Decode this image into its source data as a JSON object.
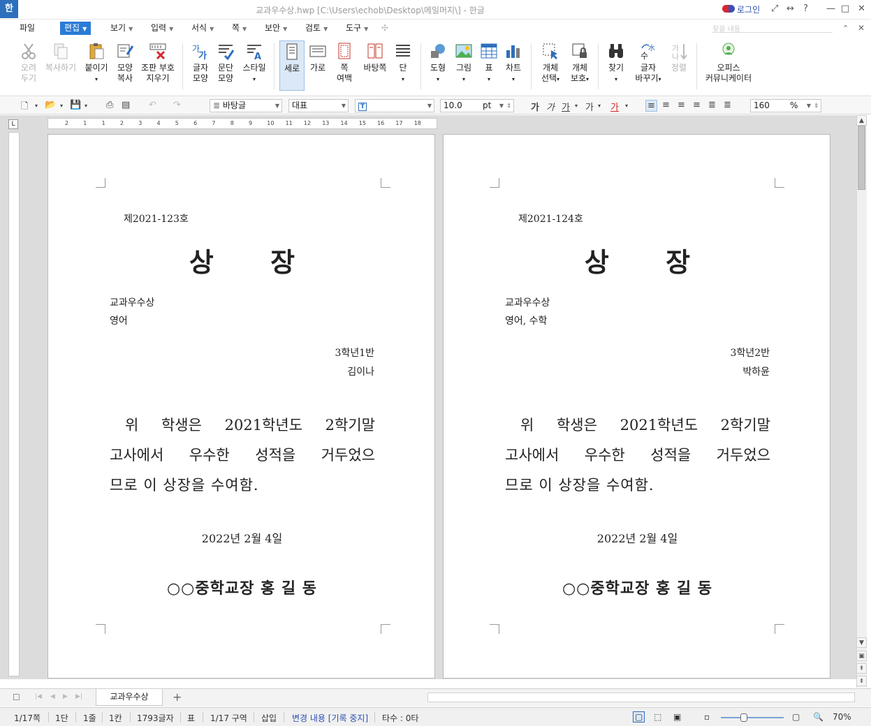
{
  "titlebar": {
    "app_logo": "한",
    "title": "교과우수상.hwp [C:\\Users\\echob\\Desktop\\메일머지\\] - 한글",
    "login": "로그인"
  },
  "menu": {
    "items": [
      {
        "label": "파일"
      },
      {
        "label": "편집"
      },
      {
        "label": "보기"
      },
      {
        "label": "입력"
      },
      {
        "label": "서식"
      },
      {
        "label": "쪽"
      },
      {
        "label": "보안"
      },
      {
        "label": "검토"
      },
      {
        "label": "도구"
      }
    ],
    "search_placeholder": "찾을 내용"
  },
  "ribbon": {
    "cut": [
      "오려",
      "두기"
    ],
    "copy": "복사하기",
    "paste": "붙이기",
    "shape_copy": [
      "모양",
      "복사"
    ],
    "clear_code": [
      "조판 부호",
      "지우기"
    ],
    "char_shape": [
      "글자",
      "모양"
    ],
    "para_shape": [
      "문단",
      "모양"
    ],
    "style": "스타일",
    "portrait": "세로",
    "landscape": "가로",
    "margin": [
      "쪽",
      "여백"
    ],
    "page_bg": "바탕쪽",
    "columns": "단",
    "shapes": "도형",
    "picture": "그림",
    "table": "표",
    "chart": "차트",
    "object_select": [
      "개체",
      "선택"
    ],
    "object_protect": [
      "개체",
      "보호"
    ],
    "find": "찾기",
    "replace": [
      "글자",
      "바꾸기"
    ],
    "arrange": "정렬",
    "office_comm": [
      "오피스",
      "커뮤니케이터"
    ]
  },
  "formatbar": {
    "style": "바탕글",
    "font_lang": "대표",
    "font": "",
    "size": "10.0",
    "unit": "pt",
    "zoom": "160",
    "zoom_unit": "%"
  },
  "ruler": {
    "h_ticks": [
      "2",
      "1",
      "1",
      "2",
      "3",
      "4",
      "5",
      "6",
      "7",
      "8",
      "9",
      "10",
      "11",
      "12",
      "13",
      "14",
      "15",
      "16",
      "17",
      "18"
    ]
  },
  "pages": [
    {
      "cert_no": "제2021-123호",
      "title": "상 장",
      "award": "교과우수상",
      "subject": "영어",
      "class": "3학년1반",
      "name": "김이나",
      "body": [
        "위 학생은 2021학년도 2학기말",
        "고사에서 우수한 성적을 거두었으",
        "므로 이 상장을 수여함."
      ],
      "date": "2022년 2월 4일",
      "sign": "○○중학교장 홍 길 동"
    },
    {
      "cert_no": "제2021-124호",
      "title": "상 장",
      "award": "교과우수상",
      "subject": "영어, 수학",
      "class": "3학년2반",
      "name": "박하윤",
      "body": [
        "위 학생은 2021학년도 2학기말",
        "고사에서 우수한 성적을 거두었으",
        "므로 이 상장을 수여함."
      ],
      "date": "2022년 2월 4일",
      "sign": "○○중학교장 홍 길 동"
    }
  ],
  "tabs": {
    "doc_tab": "교과우수상",
    "add": "+"
  },
  "status": {
    "page": "1/17쪽",
    "column": "1단",
    "line": "1줄",
    "col": "1칸",
    "chars": "1793글자",
    "table": "표",
    "section": "1/17 구역",
    "insert": "삽입",
    "track": "변경 내용 [기록 중지]",
    "typing": "타수 : 0타",
    "zoom": "70%"
  }
}
